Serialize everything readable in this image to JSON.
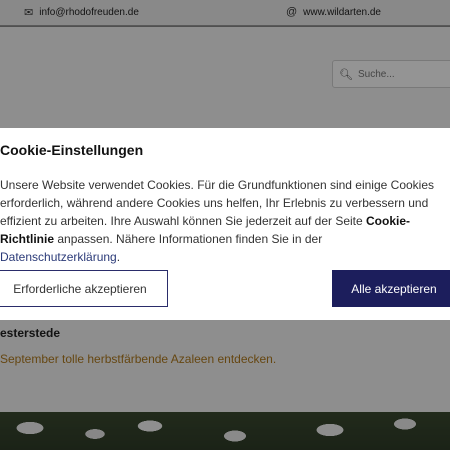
{
  "topbar": {
    "email_icon": "envelope-icon",
    "email": "info@rhodofreuden.de",
    "web_icon": "at-icon",
    "website": "www.wildarten.de"
  },
  "search": {
    "icon": "search-icon",
    "placeholder": "Suche..."
  },
  "content": {
    "title": "esterstede",
    "text": "September tolle herbstfärbende Azaleen entdecken."
  },
  "cookie_dialog": {
    "title": "Cookie-Einstellungen",
    "body_part1": "Unsere Website verwendet Cookies. Für die Grundfunktionen sind einige Cookies erforderlich, während andere Cookies uns helfen, Ihr Erlebnis zu verbessern und effizient zu arbeiten. Ihre Auswahl können Sie jederzeit auf der Seite ",
    "policy_link": "Cookie-Richtlinie",
    "body_part2": " anpassen. Nähere Informationen finden Sie in der ",
    "privacy_link": "Datenschutzerklärung",
    "body_part3": ".",
    "btn_necessary": "Erforderliche akzeptieren",
    "btn_all": "Alle akzeptieren"
  },
  "colors": {
    "accent": "#1c1e5c",
    "link": "#2b3a78",
    "highlight_text": "#b07a1e"
  }
}
